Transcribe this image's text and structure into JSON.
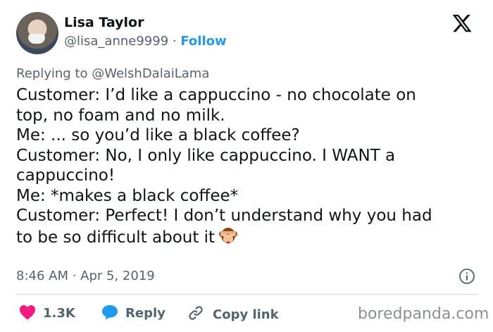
{
  "header": {
    "name": "Lisa Taylor",
    "handle": "@lisa_anne9999",
    "separator": "·",
    "follow_label": "Follow",
    "x_logo_icon": "x-logo-icon"
  },
  "replying": {
    "prefix": "Replying to",
    "mention": "@WelshDalaiLama"
  },
  "tweet": {
    "lines": [
      "Customer: I’d like a cappuccino - no chocolate on",
      "top, no foam and no milk.",
      "Me: ... so you’d like a black coffee?",
      "Customer: No, I only like cappuccino. I WANT a",
      "cappuccino!",
      "Me: *makes a black coffee*",
      "Customer: Perfect! I don’t understand why you had",
      "to be so difficult about it"
    ],
    "emoji_icon": "see-no-evil-monkey-icon"
  },
  "meta": {
    "timestamp": "8:46 AM · Apr 5, 2019",
    "info_icon": "info-icon"
  },
  "actions": {
    "like_count": "1.3K",
    "reply_label": "Reply",
    "copy_label": "Copy link"
  },
  "colors": {
    "like": "#f91880",
    "reply": "#1d9bf0",
    "link": "#1d9bf0",
    "muted": "#536471",
    "text": "#0f1419"
  },
  "watermark": "boredpanda.com"
}
